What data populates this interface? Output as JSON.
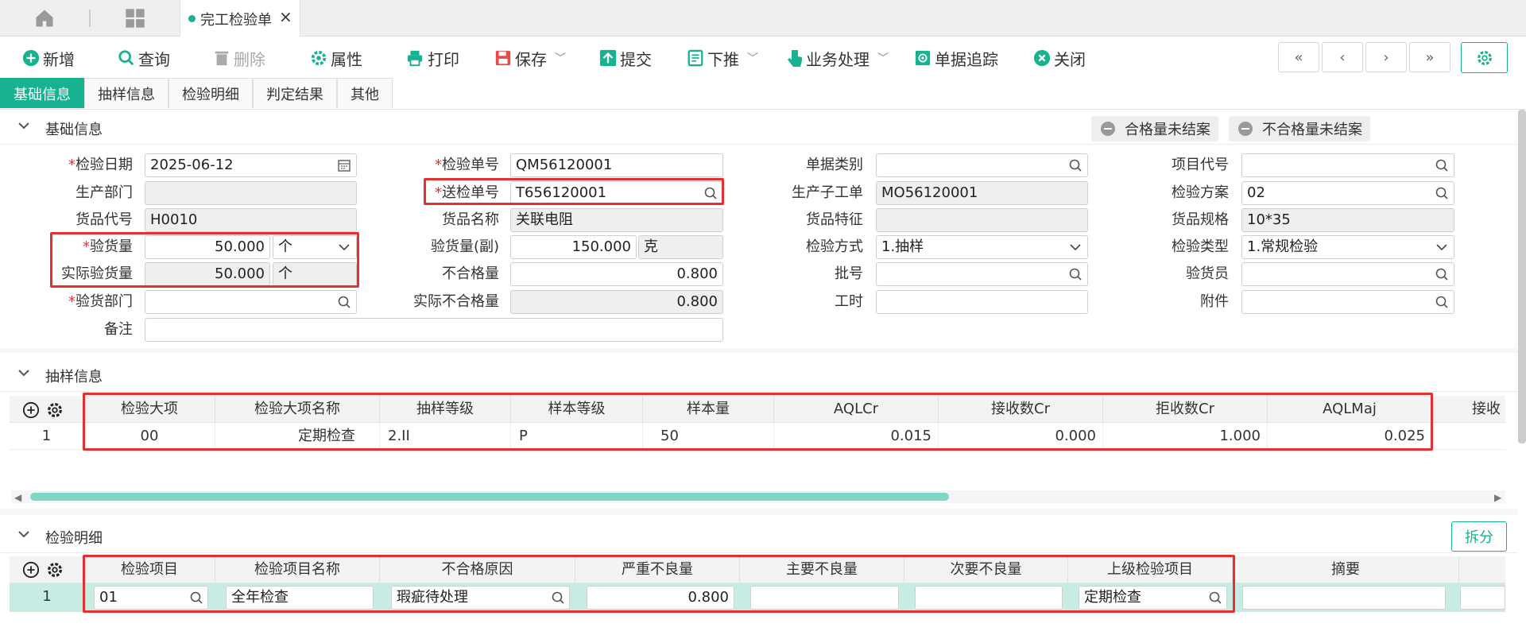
{
  "tabs": {
    "active_label": "完工检验单",
    "close": "×"
  },
  "toolbar": {
    "add": "新增",
    "query": "查询",
    "delete": "删除",
    "properties": "属性",
    "print": "打印",
    "save": "保存",
    "submit": "提交",
    "push_down": "下推",
    "business": "业务处理",
    "trace": "单据追踪",
    "close": "关闭"
  },
  "subtabs": [
    "基础信息",
    "抽样信息",
    "检验明细",
    "判定结果",
    "其他"
  ],
  "sections": {
    "basic": "基础信息",
    "sampling": "抽样信息",
    "detail": "检验明细"
  },
  "status_pills": {
    "qualified": "合格量未结案",
    "unqualified": "不合格量未结案"
  },
  "form": {
    "inspect_date": {
      "label": "检验日期",
      "value": "2025-06-12"
    },
    "prod_dept": {
      "label": "生产部门",
      "value": ""
    },
    "item_code": {
      "label": "货品代号",
      "value": "H0010"
    },
    "qty": {
      "label": "验货量",
      "value": "50.000",
      "unit": "个"
    },
    "actual_qty": {
      "label": "实际验货量",
      "value": "50.000",
      "unit": "个"
    },
    "inspect_dept": {
      "label": "验货部门",
      "value": ""
    },
    "remark": {
      "label": "备注",
      "value": ""
    },
    "doc_no": {
      "label": "检验单号",
      "value": "QM56120001"
    },
    "send_no": {
      "label": "送检单号",
      "value": "T656120001"
    },
    "item_name": {
      "label": "货品名称",
      "value": "关联电阻"
    },
    "qty_sub": {
      "label": "验货量(副)",
      "value": "150.000",
      "unit": "克"
    },
    "unqualified": {
      "label": "不合格量",
      "value": "0.800"
    },
    "actual_unqualified": {
      "label": "实际不合格量",
      "value": "0.800"
    },
    "doc_type": {
      "label": "单据类别",
      "value": ""
    },
    "sub_order": {
      "label": "生产子工单",
      "value": "MO56120001"
    },
    "item_feature": {
      "label": "货品特征",
      "value": ""
    },
    "inspect_method": {
      "label": "检验方式",
      "value": "1.抽样"
    },
    "batch": {
      "label": "批号",
      "value": ""
    },
    "work_hours": {
      "label": "工时",
      "value": ""
    },
    "project_code": {
      "label": "项目代号",
      "value": ""
    },
    "scheme": {
      "label": "检验方案",
      "value": "02"
    },
    "spec": {
      "label": "货品规格",
      "value": "10*35"
    },
    "inspect_type": {
      "label": "检验类型",
      "value": "1.常规检验"
    },
    "inspector": {
      "label": "验货员",
      "value": ""
    },
    "attachment": {
      "label": "附件",
      "value": ""
    }
  },
  "sampling_grid": {
    "headers": [
      "检验大项",
      "检验大项名称",
      "抽样等级",
      "样本等级",
      "样本量",
      "AQLCr",
      "接收数Cr",
      "拒收数Cr",
      "AQLMaj",
      "接收"
    ],
    "row": {
      "no": "1",
      "c0": "00",
      "c1": "定期检查",
      "c2": "2.II",
      "c3": "P",
      "c4": "50",
      "c5": "0.015",
      "c6": "0.000",
      "c7": "1.000",
      "c8": "0.025"
    }
  },
  "detail_grid": {
    "split": "拆分",
    "headers": [
      "检验项目",
      "检验项目名称",
      "不合格原因",
      "严重不良量",
      "主要不良量",
      "次要不良量",
      "上级检验项目",
      "摘要"
    ],
    "row": {
      "no": "1",
      "c0": "01",
      "c1": "全年检查",
      "c2": "瑕疵待处理",
      "c3": "0.800",
      "c4": "",
      "c5": "",
      "c6": "定期检查",
      "c7": ""
    }
  }
}
